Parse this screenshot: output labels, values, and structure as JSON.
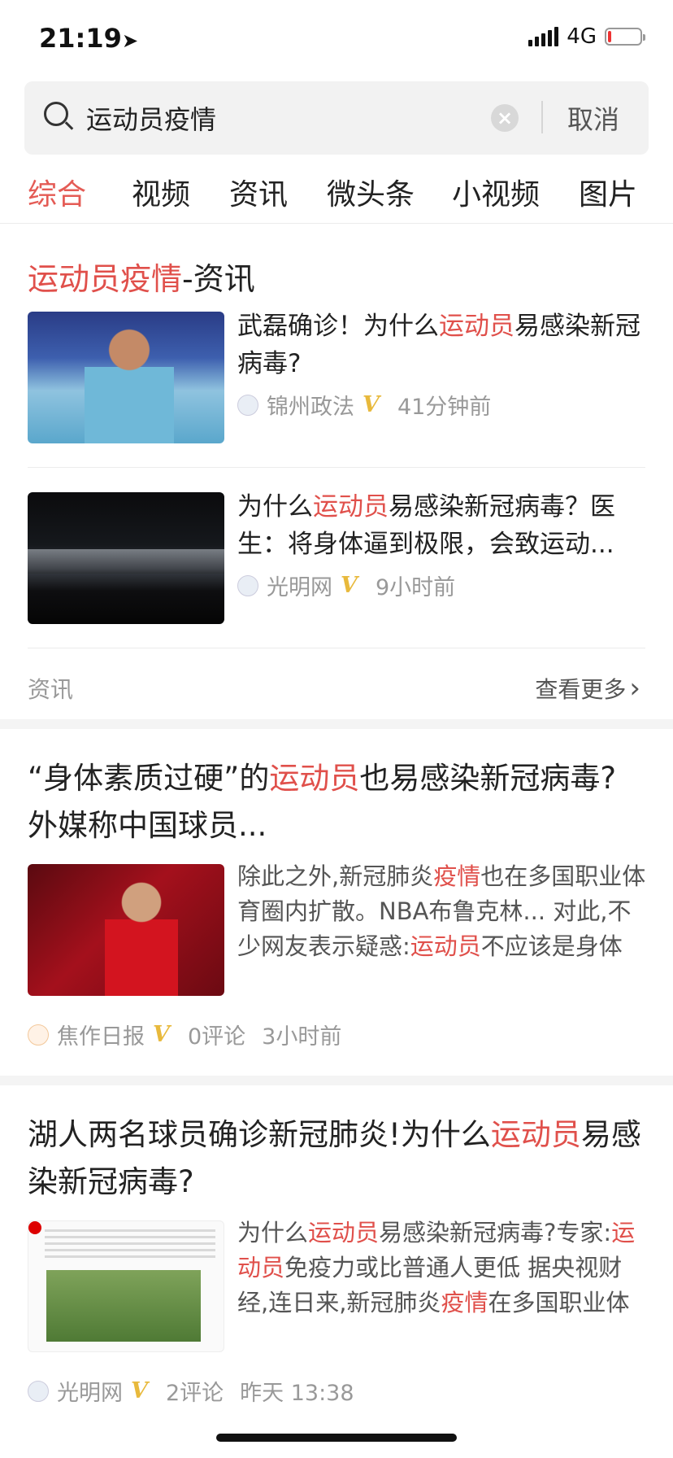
{
  "status_bar": {
    "time": "21:19",
    "network": "4G"
  },
  "search": {
    "query": "运动员疫情",
    "cancel_label": "取消",
    "clear_symbol": "×"
  },
  "tabs": [
    {
      "label": "综合",
      "active": true
    },
    {
      "label": "视频"
    },
    {
      "label": "资讯"
    },
    {
      "label": "微头条"
    },
    {
      "label": "小视频"
    },
    {
      "label": "图片"
    }
  ],
  "section": {
    "title_highlight": "运动员疫情",
    "title_suffix": "-资讯",
    "items": [
      {
        "title_before": "武磊确诊！为什么",
        "title_highlight": "运动员",
        "title_after": "易感染新冠病毒?",
        "source": "锦州政法",
        "v": "V",
        "time": "41分钟前"
      },
      {
        "title_before": "为什么",
        "title_highlight": "运动员",
        "title_after": "易感染新冠病毒？医生：将身体逼到极限，会致运动...",
        "source": "光明网",
        "v": "V",
        "time": "9小时前"
      }
    ],
    "footer_label": "资讯",
    "more_label": "查看更多",
    "more_arrow": "›"
  },
  "articles": [
    {
      "title_before": "“身体素质过硬”的",
      "title_highlight": "运动员",
      "title_after": "也易感染新冠病毒?外媒称中国球员...",
      "summary_p1": "除此之外,新冠肺炎",
      "summary_h1": "疫情",
      "summary_p2": "也在多国职业体育圈内扩散。NBA布鲁克林... 对此,不少网友表示疑惑:",
      "summary_h2": "运动员",
      "summary_p3": "不应该是身体更...",
      "source": "焦作日报",
      "v": "V",
      "comments": "0评论",
      "time": "3小时前"
    },
    {
      "title_before": "湖人两名球员确诊新冠肺炎!为什么",
      "title_highlight": "运动员",
      "title_after": "易感染新冠病毒?",
      "summary_p1": "为什么",
      "summary_h1": "运动员",
      "summary_p2": "易感染新冠病毒?专家:",
      "summary_h2": "运动员",
      "summary_p3": "免疫力或比普通人更低 据央视财经,连日来,新冠肺炎",
      "summary_h3": "疫情",
      "summary_p4": "在多国职业体育...",
      "source": "光明网",
      "v": "V",
      "comments": "2评论",
      "time": "昨天 13:38"
    }
  ],
  "colors": {
    "accent": "#e0504b",
    "verified": "#e8b93c"
  }
}
